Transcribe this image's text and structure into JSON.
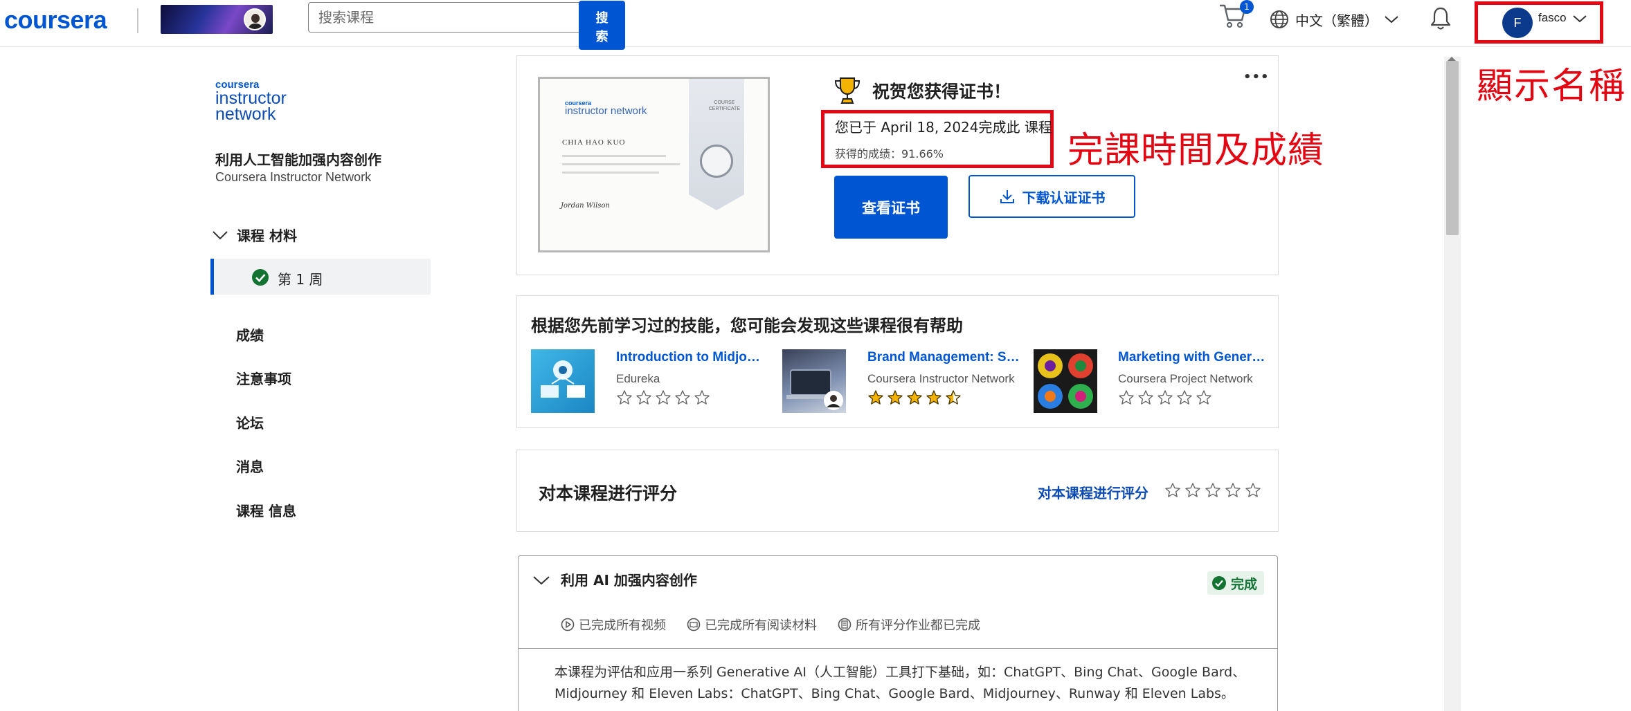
{
  "header": {
    "logo_text": "coursera",
    "search_placeholder": "搜索课程",
    "search_button": "搜\n索",
    "cart_count": "1",
    "language": "中文（繁體）",
    "user_initial": "F",
    "user_name": "fasco"
  },
  "annotations": {
    "display_name": "顯示名稱",
    "completion_time": "完課時間及成績",
    "color": "#e30613"
  },
  "sidebar": {
    "logo_line1": "coursera",
    "logo_line2": "instructor",
    "logo_line3": "network",
    "course_title": "利用人工智能加强内容创作",
    "course_provider": "Coursera Instructor Network",
    "materials_label": "课程 材料",
    "week_label": "第 1 周",
    "nav_items": [
      {
        "label": "成绩"
      },
      {
        "label": "注意事项"
      },
      {
        "label": "论坛"
      },
      {
        "label": "消息"
      },
      {
        "label": "课程 信息"
      }
    ]
  },
  "certificate": {
    "congrats": "祝贺您获得证书！",
    "completed_text": "您已于 April 18, 2024完成此 课程",
    "grade_text": "获得的成绩：91.66%",
    "view_button": "查看证书",
    "download_button": "下载认证证书",
    "more_icon": "more-horizontal-icon",
    "thumb": {
      "logo1": "coursera",
      "logo2": "instructor network",
      "name": "CHIA HAO KUO",
      "signature": "Jordan Wilson",
      "corner": "COURSE\nCERTIFICATE"
    }
  },
  "recommendations": {
    "title": "根据您先前学习过的技能，您可能会发现这些课程很有帮助",
    "items": [
      {
        "name": "Introduction to Midjo…",
        "org": "Edureka",
        "rating": 0
      },
      {
        "name": "Brand Management: S…",
        "org": "Coursera Instructor Network",
        "rating": 4.5
      },
      {
        "name": "Marketing with Gener…",
        "org": "Coursera Project Network",
        "rating": 0
      }
    ]
  },
  "rating": {
    "title": "对本课程进行评分",
    "link": "对本课程进行评分",
    "stars": 0
  },
  "module": {
    "title": "利用 AI 加强内容创作",
    "badge": "完成",
    "stats": [
      "已完成所有视频",
      "已完成所有阅读材料",
      "所有评分作业都已完成"
    ],
    "description": "本课程为评估和应用一系列 Generative AI（人工智能）工具打下基础，如：ChatGPT、Bing Chat、Google Bard、Midjourney 和 Eleven Labs：ChatGPT、Bing Chat、Google Bard、Midjourney、Runway 和 Eleven Labs。"
  },
  "colors": {
    "brand": "#0056d2",
    "success": "#137333",
    "star": "#f5b301"
  }
}
